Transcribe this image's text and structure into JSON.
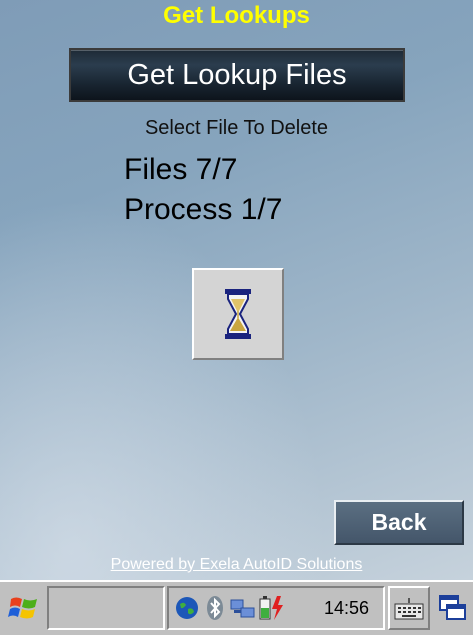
{
  "window": {
    "title": "Get Lookups"
  },
  "main": {
    "get_button_label": "Get Lookup Files",
    "subtitle": "Select File To Delete",
    "files_progress": "Files 7/7",
    "process_progress": "Process 1/7",
    "back_label": "Back",
    "powered_by": "Powered by Exela AutoID Solutions"
  },
  "taskbar": {
    "clock": "14:56",
    "icons": [
      "windows-start-icon",
      "globe-icon",
      "bluetooth-icon",
      "network-icon",
      "battery-charging-icon",
      "keyboard-icon",
      "switch-windows-icon"
    ]
  },
  "colors": {
    "title": "#ffff00",
    "button_dark": "#1e2a36",
    "back_button": "#4f6478"
  }
}
